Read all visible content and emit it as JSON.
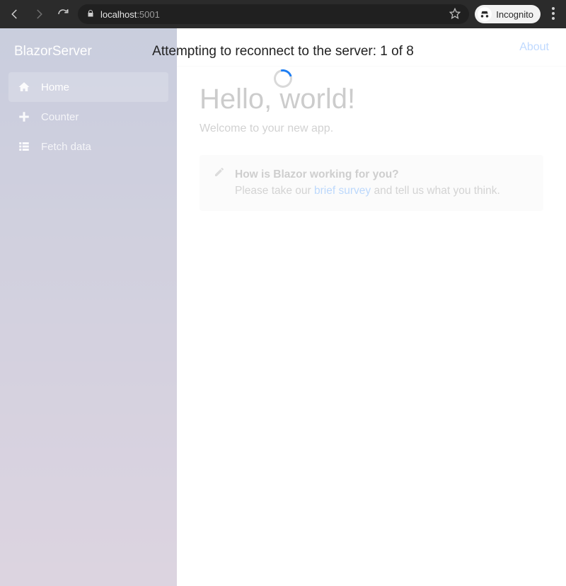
{
  "browser": {
    "url_host": "localhost",
    "url_port": ":5001",
    "incognito_label": "Incognito"
  },
  "sidebar": {
    "brand": "BlazorServer",
    "items": [
      {
        "label": "Home"
      },
      {
        "label": "Counter"
      },
      {
        "label": "Fetch data"
      }
    ]
  },
  "topbar": {
    "about_label": "About"
  },
  "main": {
    "heading": "Hello, world!",
    "subtitle": "Welcome to your new app.",
    "survey": {
      "strong": "How is Blazor working for you?",
      "prefix": "Please take our ",
      "link_text": "brief survey",
      "suffix": " and tell us what you think."
    }
  },
  "reconnect": {
    "message": "Attempting to reconnect to the server: 1 of 8"
  }
}
